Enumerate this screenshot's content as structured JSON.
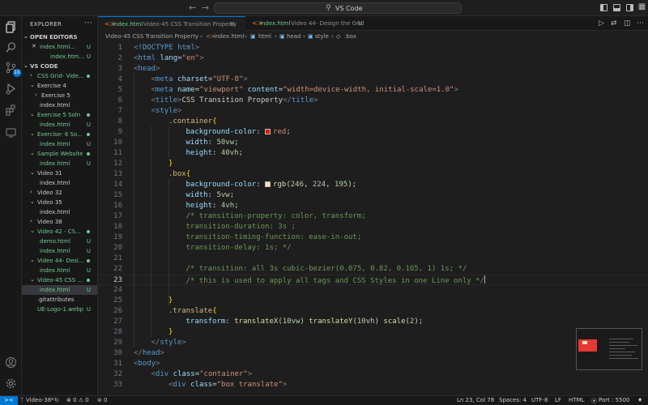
{
  "window": {
    "title": "VS Code"
  },
  "sidebar": {
    "title": "EXPLORER",
    "open_editors": {
      "label": "OPEN EDITORS",
      "items": [
        {
          "name": "index.html...",
          "status": "U"
        },
        {
          "name": "index.html...",
          "status": "U"
        }
      ]
    },
    "workspace": {
      "label": "VS CODE",
      "items": [
        {
          "name": "CSS Grid- Vide...",
          "kind": "folder",
          "status": "dot"
        },
        {
          "name": "Exercise 4",
          "kind": "folder",
          "status": ""
        },
        {
          "name": "Exercise 5",
          "kind": "folder",
          "status": ""
        },
        {
          "name": "index.html",
          "kind": "file",
          "status": ""
        },
        {
          "name": "Exercise 5 Soln",
          "kind": "folder",
          "status": "dot"
        },
        {
          "name": "index.html",
          "kind": "file",
          "status": "U"
        },
        {
          "name": "Exercise- 6 So...",
          "kind": "folder",
          "status": "dot"
        },
        {
          "name": "index.html",
          "kind": "file",
          "status": "U"
        },
        {
          "name": "Sample Website",
          "kind": "folder",
          "status": "dot"
        },
        {
          "name": "index.html",
          "kind": "file",
          "status": "U"
        },
        {
          "name": "Video 31",
          "kind": "folder",
          "status": ""
        },
        {
          "name": "index.html",
          "kind": "file",
          "status": ""
        },
        {
          "name": "Video 32",
          "kind": "folder",
          "status": ""
        },
        {
          "name": "Video 35",
          "kind": "folder",
          "status": ""
        },
        {
          "name": "index.html",
          "kind": "file",
          "status": ""
        },
        {
          "name": "Video 38",
          "kind": "folder",
          "status": ""
        },
        {
          "name": "Video 42 - CS...",
          "kind": "folder",
          "status": "dot"
        },
        {
          "name": "demo.html",
          "kind": "file",
          "status": "U"
        },
        {
          "name": "index.html",
          "kind": "file",
          "status": "U"
        },
        {
          "name": "Video 44- Desi...",
          "kind": "folder",
          "status": "dot"
        },
        {
          "name": "index.html",
          "kind": "file",
          "status": "U"
        },
        {
          "name": "Video-45 CSS ...",
          "kind": "folder",
          "status": "dot"
        },
        {
          "name": "index.html",
          "kind": "file",
          "status": "U"
        },
        {
          "name": ".gitattributes",
          "kind": "file",
          "status": ""
        },
        {
          "name": "UE-Logo-1.webp",
          "kind": "file",
          "status": "U"
        }
      ]
    }
  },
  "tabs": [
    {
      "name": "index.html",
      "desc": "Video-45 CSS Transition Property",
      "status": "U"
    },
    {
      "name": "index.html",
      "desc": "Video 44- Design the Grid",
      "status": "U"
    }
  ],
  "breadcrumb": [
    "Video-45 CSS Transition Property",
    "index.html",
    "html",
    "head",
    "style",
    ".box"
  ],
  "editor": {
    "line_numbers": [
      "1",
      "2",
      "3",
      "4",
      "5",
      "6",
      "7",
      "8",
      "9",
      "10",
      "11",
      "12",
      "13",
      "14",
      "15",
      "16",
      "17",
      "18",
      "19",
      "20",
      "21",
      "22",
      "23",
      "24",
      "25",
      "26",
      "27",
      "28",
      "29",
      "30",
      "31",
      "32",
      "33"
    ],
    "current_line": "23",
    "lines": [
      "<!DOCTYPE html>",
      "<html lang=\"en\">",
      "<head>",
      "<meta charset=\"UTF-8\">",
      "<meta name=\"viewport\" content=\"width=device-width, initial-scale=1.0\">",
      "<title>CSS Transition Property</title>",
      "<style>",
      ".container{",
      "background-color: red;",
      "width: 50vw;",
      "height: 40vh;",
      "}",
      ".box{",
      "background-color: rgb(246, 224, 195);",
      "width: 5vw;",
      "height: 4vh;",
      "/* transition-property: color, transform;",
      "transition-duration: 3s ;",
      "transition-timing-function: ease-in-out;",
      "transition-delay: 1s; */",
      "",
      "/* transition: all 3s cubic-bezier(0.075, 0.82, 0.165, 1) 1s; */",
      "/* this is used to apply all tags and CSS Styles in one Line only */",
      "",
      "}",
      ".translate{",
      "transform: translateX(10vw) translateY(10vh) scale(2);",
      "}",
      "</style>",
      "</head>",
      "<body>",
      "<div class=\"container\">",
      "<div class=\"box translate\">"
    ],
    "colors": {
      "red_swatch": "#e51400",
      "beige_swatch": "#f6e0c3"
    }
  },
  "statusbar": {
    "remote": "><",
    "branch": "Video-38*",
    "problems": "⊗ 0 ⚠ 0",
    "ports": "0",
    "position": "Ln 23, Col 78",
    "spaces": "Spaces: 4",
    "encoding": "UTF-8",
    "eol": "LF",
    "language": "HTML",
    "port": "Port : 5500"
  }
}
